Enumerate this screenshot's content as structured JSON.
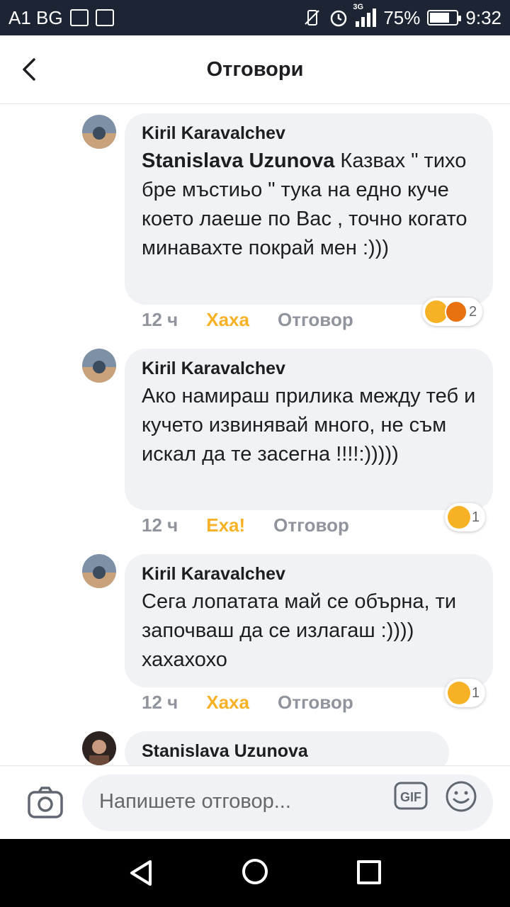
{
  "status_bar": {
    "carrier": "A1 BG",
    "network": "3G",
    "battery": "75%",
    "battery_level": 0.75,
    "time": "9:32"
  },
  "header": {
    "title": "Отговори"
  },
  "comments": [
    {
      "author": "Kiril Karavalchev",
      "mention": "Stanislava Uzunova",
      "text": " Казвах \" тихо бре мъстиьо \" тука на едно куче което лаеше по Вас , точно когато минавахте покрай мен :)))",
      "time": "12 ч",
      "reaction_label": "Хаха",
      "reply_label": "Отговор",
      "reaction_icons": [
        "haha-icon",
        "angry-icon"
      ],
      "reaction_count": "2"
    },
    {
      "author": "Kiril Karavalchev",
      "text": "Ако намираш прилика между теб и кучето извинявай много, не съм искал да те засегна !!!!:)))))",
      "time": "12 ч",
      "reaction_label": "Еха!",
      "reply_label": "Отговор",
      "reaction_icons": [
        "wow-icon"
      ],
      "reaction_count": "1"
    },
    {
      "author": "Kiril Karavalchev",
      "text": "Сега лопатата май се обърна, ти започваш да се излагаш :)))) хахахохо",
      "time": "12 ч",
      "reaction_label": "Хаха",
      "reply_label": "Отговор",
      "reaction_icons": [
        "haha-icon"
      ],
      "reaction_count": "1"
    },
    {
      "author": "Stanislava Uzunova"
    }
  ],
  "reply_bar": {
    "placeholder": "Напишете отговор...",
    "gif_label": "GIF"
  },
  "colors": {
    "status_bar": "#1d2535",
    "bubble": "#f0f2f5",
    "reaction_label": "#f7b125",
    "meta_text": "#90949c"
  }
}
